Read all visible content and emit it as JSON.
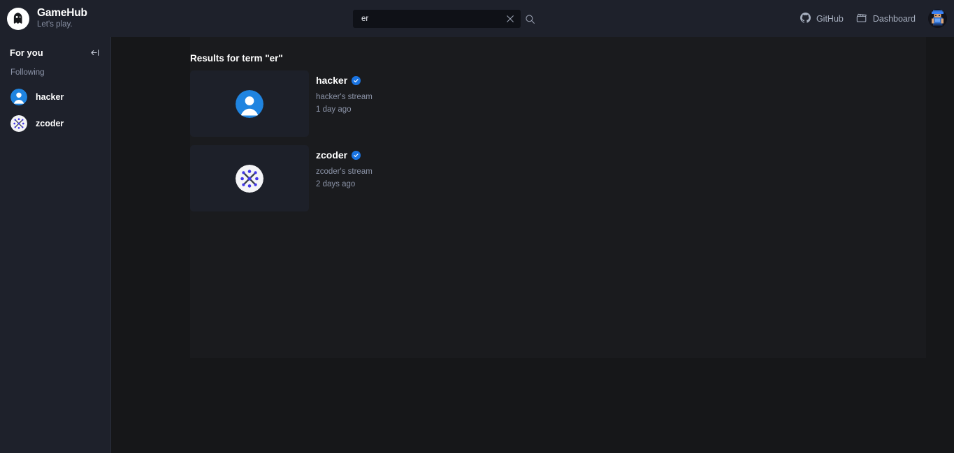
{
  "header": {
    "brand_name": "GameHub",
    "brand_tagline": "Let's play.",
    "logo_icon": "ghost-logo-icon",
    "search": {
      "value": "er",
      "placeholder": "Search",
      "clear_icon": "close-icon",
      "search_icon": "search-icon"
    },
    "links": [
      {
        "label": "GitHub",
        "icon": "github-icon"
      },
      {
        "label": "Dashboard",
        "icon": "clapperboard-icon"
      }
    ],
    "avatar_icon": "user-avatar-pixel-art"
  },
  "sidebar": {
    "title": "For you",
    "collapse_icon": "collapse-sidebar-icon",
    "section_label": "Following",
    "items": [
      {
        "label": "hacker",
        "avatar": "person-avatar-blue"
      },
      {
        "label": "zcoder",
        "avatar": "molecule-avatar-white"
      }
    ]
  },
  "main": {
    "results_title": "Results for term \"er\"",
    "results": [
      {
        "name": "hacker",
        "verified": true,
        "verified_icon": "verified-check-icon",
        "subtitle": "hacker's stream",
        "time": "1 day ago",
        "thumb_avatar": "person-avatar-blue"
      },
      {
        "name": "zcoder",
        "verified": true,
        "verified_icon": "verified-check-icon",
        "subtitle": "zcoder's stream",
        "time": "2 days ago",
        "thumb_avatar": "molecule-avatar-white"
      }
    ]
  },
  "colors": {
    "page_bg": "#161719",
    "panel_bg": "#1e212b",
    "content_bg": "#1a1b1e",
    "card_bg": "#1d2029",
    "accent_blue": "#1a74e2",
    "muted_text": "#8b93a7"
  }
}
